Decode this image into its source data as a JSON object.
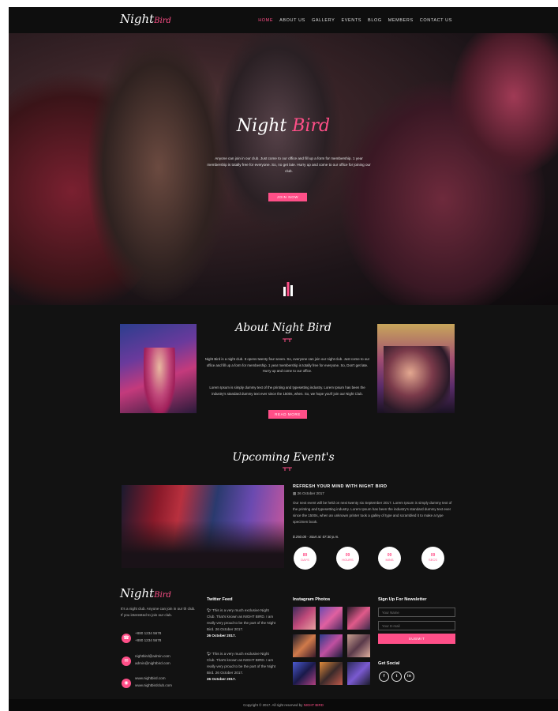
{
  "header": {
    "logo_main": "Night",
    "logo_accent": "Bird",
    "nav": [
      {
        "label": "HOME",
        "active": true
      },
      {
        "label": "ABOUT US",
        "active": false
      },
      {
        "label": "GALLERY",
        "active": false
      },
      {
        "label": "EVENTS",
        "active": false
      },
      {
        "label": "BLOG",
        "active": false
      },
      {
        "label": "MEMBERS",
        "active": false
      },
      {
        "label": "CONTACT US",
        "active": false
      }
    ]
  },
  "hero": {
    "title_main": "Night",
    "title_accent": "Bird",
    "text": "Anyone can join in our club. Just come to our office and fill up a form for membership. 1 year membership is totally free for everyone. So, no get late. Hurry up and come to our office for joining our club.",
    "button": "JOIN NOW",
    "scroll_icon": "equalizer-icon"
  },
  "about": {
    "title": "About Night Bird",
    "para1": "Night Bird is a night club. It opens twenty four seven. So, everyone can join our night club. Just come to our office and fill up a form for membership. 1 year membership is totally free for everyone. So, Don't get late. Hurry up and come to our office.",
    "para2": "Lorem Ipsum is simply dummy text of the printing and typesetting industry. Lorem Ipsum has been the industry's standard dummy text ever since the 1500s, when. So, we hope you'll join our Night Club.",
    "button": "READ MORE"
  },
  "events": {
    "title": "Upcoming Event's",
    "item": {
      "title": "REFRESH YOUR MIND WITH NIGHT BIRD",
      "date": "26 October 2017",
      "description": "Our next event will be held on next twenty six September 2017. Lorem Ipsum is simply dummy text of the printing and typesetting industry. Lorem Ipsum has been the industry's standard dummy text ever since the 1500s, when an unknown printer took a galley of type and scrambled it to make a type specimen book.",
      "price": "$ 250.00 - Start at: 07:30 p.m.",
      "countdown": [
        {
          "value": "89",
          "unit": "DAYS"
        },
        {
          "value": "09",
          "unit": "HOURS"
        },
        {
          "value": "09",
          "unit": "MINS"
        },
        {
          "value": "09",
          "unit": "SECS"
        }
      ]
    }
  },
  "footer": {
    "logo_main": "Night",
    "logo_accent": "Bird",
    "about_text": "It's a night club. Anyone can join in our th club. If you interested to join our club.",
    "phone1": "+880 1234 5678",
    "phone2": "+880 1234 5678",
    "email1": "nightbird@admin.com",
    "email2": "admin@nightbird.com",
    "web1": "www.nightbird.com",
    "web2": "www.nightbirdclub.com",
    "twitter_title": "Twitter Feed",
    "tweets": [
      {
        "text": "This is a very much exclusive Night Club. That's known as NIGHT BIRD. I am really very proud to be the part of the Night Bird. 26 October 2017.",
        "date": "26 October 2017."
      },
      {
        "text": "This is a very much exclusive Night Club. That's known as NIGHT BIRD. I am really very proud to be the part of the Night Bird. 26 October 2017.",
        "date": "26 October 2017."
      }
    ],
    "instagram_title": "Instagram Photos",
    "newsletter_title": "Sign Up For Newsletter",
    "name_placeholder": "Your Name",
    "email_placeholder": "Your E-mail",
    "submit": "SUBMIT",
    "social_title": "Get Social",
    "social": [
      {
        "icon": "facebook-icon",
        "glyph": "f"
      },
      {
        "icon": "twitter-icon",
        "glyph": "t"
      },
      {
        "icon": "linkedin-icon",
        "glyph": "in"
      }
    ],
    "copyright_pre": "Copyright © 2017. All right reserved by",
    "copyright_brand": "NIGHT BIRD"
  },
  "colors": {
    "accent": "#ff4f88",
    "background": "#121212"
  }
}
